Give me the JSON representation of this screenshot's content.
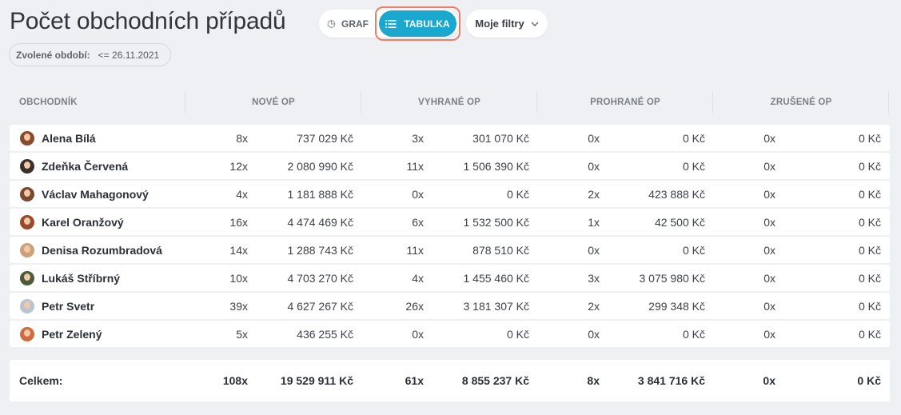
{
  "header": {
    "title": "Počet obchodních případů",
    "period_label": "Zvolené období:",
    "period_value": "<= 26.11.2021"
  },
  "view_toggle": {
    "graph_label": "GRAF",
    "table_label": "TABULKA",
    "active": "TABULKA",
    "graph_icon": "pie-chart-icon",
    "table_icon": "list-icon"
  },
  "filters": {
    "label": "Moje filtry",
    "icon": "chevron-down-icon"
  },
  "colors": {
    "accent": "#1ba8cf",
    "highlight": "#e8816c",
    "background": "#eef0f3"
  },
  "table": {
    "columns": [
      "OBCHODNÍK",
      "NOVÉ OP",
      "VYHRANÉ OP",
      "PROHRANÉ OP",
      "ZRUŠENÉ OP"
    ],
    "rows": [
      {
        "name": "Alena Bílá",
        "avatar": "#8a4a2c",
        "new_cnt": "8x",
        "new_amt": "737 029 Kč",
        "won_cnt": "3x",
        "won_amt": "301 070 Kč",
        "lost_cnt": "0x",
        "lost_amt": "0 Kč",
        "canc_cnt": "0x",
        "canc_amt": "0 Kč"
      },
      {
        "name": "Zdeňka Červená",
        "avatar": "#3b3030",
        "new_cnt": "12x",
        "new_amt": "2 080 990 Kč",
        "won_cnt": "11x",
        "won_amt": "1 506 390 Kč",
        "lost_cnt": "0x",
        "lost_amt": "0 Kč",
        "canc_cnt": "0x",
        "canc_amt": "0 Kč"
      },
      {
        "name": "Václav Mahagonový",
        "avatar": "#7a4a30",
        "new_cnt": "4x",
        "new_amt": "1 181 888 Kč",
        "won_cnt": "0x",
        "won_amt": "0 Kč",
        "lost_cnt": "2x",
        "lost_amt": "423 888 Kč",
        "canc_cnt": "0x",
        "canc_amt": "0 Kč"
      },
      {
        "name": "Karel Oranžový",
        "avatar": "#9a4a28",
        "new_cnt": "16x",
        "new_amt": "4 474 469 Kč",
        "won_cnt": "6x",
        "won_amt": "1 532 500 Kč",
        "lost_cnt": "1x",
        "lost_amt": "42 500 Kč",
        "canc_cnt": "0x",
        "canc_amt": "0 Kč"
      },
      {
        "name": "Denisa Rozumbradová",
        "avatar": "#c9a27a",
        "new_cnt": "14x",
        "new_amt": "1 288 743 Kč",
        "won_cnt": "11x",
        "won_amt": "878 510 Kč",
        "lost_cnt": "0x",
        "lost_amt": "0 Kč",
        "canc_cnt": "0x",
        "canc_amt": "0 Kč"
      },
      {
        "name": "Lukáš Stříbrný",
        "avatar": "#4a5a3a",
        "new_cnt": "10x",
        "new_amt": "4 703 270 Kč",
        "won_cnt": "4x",
        "won_amt": "1 455 460 Kč",
        "lost_cnt": "3x",
        "lost_amt": "3 075 980 Kč",
        "canc_cnt": "0x",
        "canc_amt": "0 Kč"
      },
      {
        "name": "Petr Svetr",
        "avatar": "#b8c4d0",
        "new_cnt": "39x",
        "new_amt": "4 627 267 Kč",
        "won_cnt": "26x",
        "won_amt": "3 181 307 Kč",
        "lost_cnt": "2x",
        "lost_amt": "299 348 Kč",
        "canc_cnt": "0x",
        "canc_amt": "0 Kč"
      },
      {
        "name": "Petr Zelený",
        "avatar": "#d06a40",
        "new_cnt": "5x",
        "new_amt": "436 255 Kč",
        "won_cnt": "0x",
        "won_amt": "0 Kč",
        "lost_cnt": "0x",
        "lost_amt": "0 Kč",
        "canc_cnt": "0x",
        "canc_amt": "0 Kč"
      }
    ],
    "total": {
      "label": "Celkem:",
      "new_cnt": "108x",
      "new_amt": "19 529 911 Kč",
      "won_cnt": "61x",
      "won_amt": "8 855 237 Kč",
      "lost_cnt": "8x",
      "lost_amt": "3 841 716 Kč",
      "canc_cnt": "0x",
      "canc_amt": "0 Kč"
    }
  }
}
